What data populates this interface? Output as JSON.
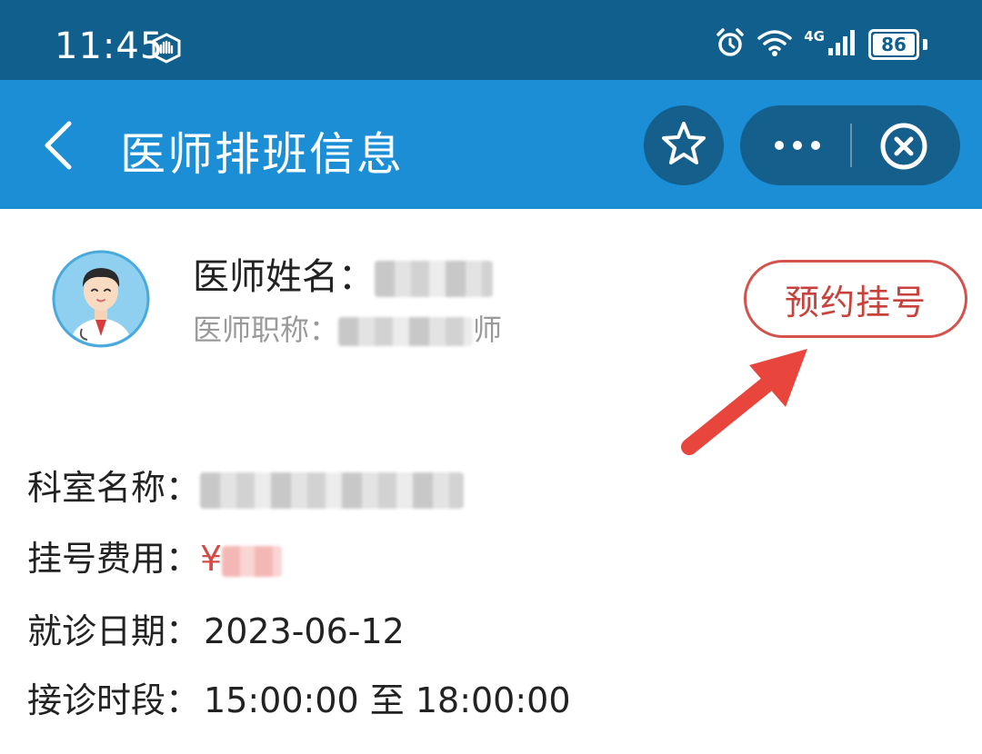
{
  "status_bar": {
    "time": "11:45",
    "battery": "86",
    "network": "4G",
    "icons": [
      "hand-shield-icon",
      "alarm-icon",
      "wifi-icon",
      "signal-icon",
      "battery-icon"
    ]
  },
  "nav": {
    "title": "医师排班信息",
    "icons": [
      "back-chevron-icon",
      "star-icon",
      "more-dots-icon",
      "close-circle-icon"
    ]
  },
  "doctor": {
    "name_label": "医师姓名：",
    "title_label": "医师职称：",
    "title_suffix": "师",
    "book_button": "预约挂号"
  },
  "info": {
    "department_label": "科室名称：",
    "fee_label": "挂号费用：",
    "fee_currency": "¥",
    "date_label": "就诊日期：",
    "date_value": "2023-06-12",
    "time_label": "接诊时段：",
    "time_value": "15:00:00 至 18:00:00"
  },
  "colors": {
    "status_bar": "#115f8d",
    "nav_bar": "#1b8ed6",
    "nav_buttons": "#155f8d",
    "book_button": "#d4524c",
    "annotation_arrow": "#e8453c"
  }
}
